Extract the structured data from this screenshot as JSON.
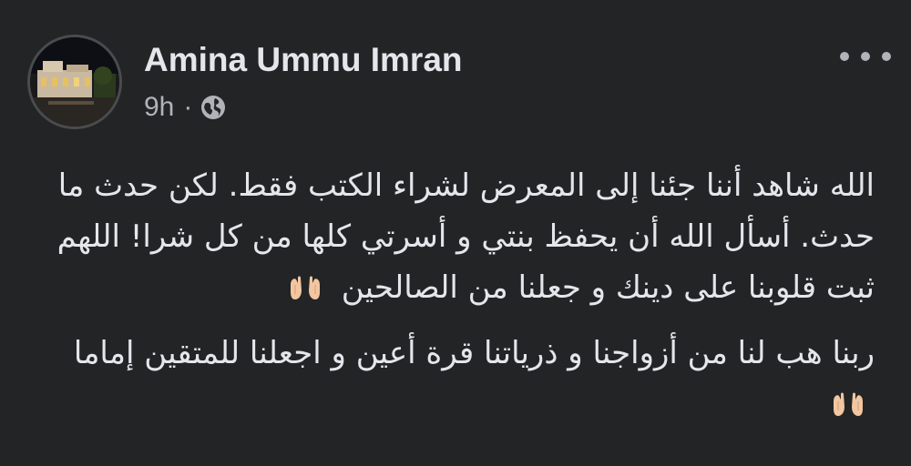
{
  "post": {
    "author": "Amina Ummu Imran",
    "timestamp": "9h",
    "separator": "·",
    "privacy_icon": "globe-icon",
    "more_icon": "more-horizontal-icon",
    "avatar_icon": "profile-photo-building-night",
    "paragraphs": [
      "الله شاهد أننا جئنا إلى المعرض لشراء الكتب فقط. لكن حدث ما حدث. أسأل الله أن يحفظ بنتي و أسرتي كلها من كل شرا! اللهم ثبت قلوبنا على دينك و جعلنا من الصالحين",
      "ربنا هب لنا من أزواجنا و ذرياتنا قرة أعين و اجعلنا للمتقين إماما"
    ],
    "emoji_icon": "raised-palms-icon"
  },
  "colors": {
    "background": "#242526",
    "text_primary": "#e4e6eb",
    "text_secondary": "#b0b3b8",
    "emoji_skin": "#f1c6a0"
  }
}
